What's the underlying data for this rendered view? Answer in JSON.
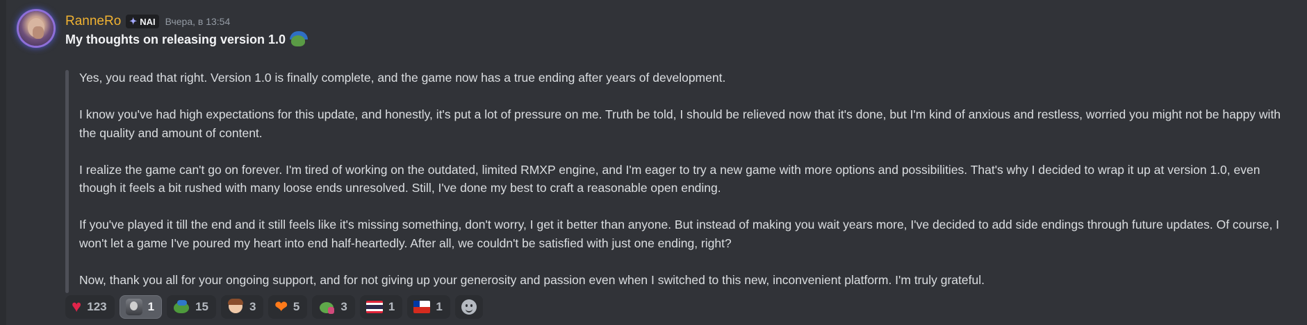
{
  "message": {
    "author": "RanneRo",
    "tag": "NAI",
    "timestamp": "Вчера, в 13:54",
    "title": "My thoughts on releasing version 1.0",
    "paragraphs": [
      "Yes, you read that right. Version 1.0 is finally complete, and the game now has a true ending after years of development.",
      "I know you've had high expectations for this update, and honestly, it's put a lot of pressure on me. Truth be told, I should be relieved now that it's done, but I'm kind of anxious and restless, worried you might not be happy with the quality and amount of content.",
      "I realize the game can't go on forever. I'm tired of working on the outdated, limited RMXP engine, and I'm eager to try a new game with more options and possibilities. That's why I decided to wrap it up at version 1.0, even though it feels a bit rushed with many loose ends unresolved. Still, I've done my best to craft a reasonable open ending.",
      "If you've played it till the end and it still feels like it's missing something, don't worry, I get it better than anyone. But instead of making you wait years more, I've decided to add side endings through future updates. Of course, I won't let a game I've poured my heart into end half-heartedly. After all, we couldn't be satisfied with just one ending, right?",
      "Now, thank you all for your ongoing support, and for not giving up your generosity and passion even when I switched to this new, inconvenient platform. I'm truly grateful."
    ]
  },
  "reactions": [
    {
      "emoji": "heart",
      "count": "123"
    },
    {
      "emoji": "avatar",
      "count": "1",
      "active": true
    },
    {
      "emoji": "frog-umbrella",
      "count": "15"
    },
    {
      "emoji": "anime-face",
      "count": "3"
    },
    {
      "emoji": "fire-heart",
      "count": "5"
    },
    {
      "emoji": "pepe-cup",
      "count": "3"
    },
    {
      "emoji": "flag-thailand",
      "count": "1"
    },
    {
      "emoji": "flag-chile",
      "count": "1"
    }
  ],
  "colors": {
    "background": "#313338",
    "username": "#f0b232",
    "text": "#dbdee1",
    "quote_bar": "#4e5058"
  }
}
